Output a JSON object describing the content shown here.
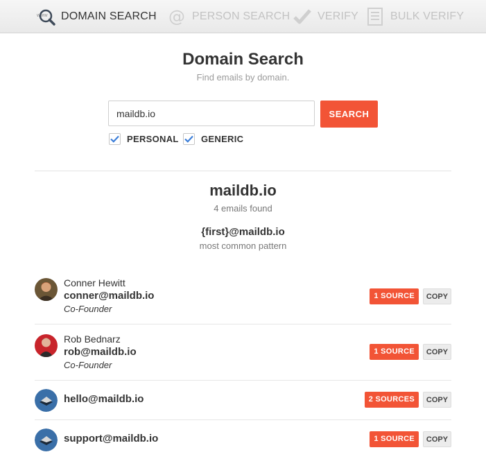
{
  "nav": {
    "domain_search": "DOMAIN SEARCH",
    "person_search": "PERSON SEARCH",
    "verify": "VERIFY",
    "bulk_verify": "BULK VERIFY",
    "icons": [
      "www-magnifier-icon",
      "at-sign-icon",
      "checkmark-icon",
      "document-list-icon"
    ],
    "active": "domain_search"
  },
  "header": {
    "title": "Domain Search",
    "subtitle": "Find emails by domain."
  },
  "search": {
    "value": "maildb.io",
    "placeholder": "",
    "button": "SEARCH",
    "filters": [
      {
        "label": "PERSONAL",
        "checked": true
      },
      {
        "label": "GENERIC",
        "checked": true
      }
    ]
  },
  "results": {
    "domain": "maildb.io",
    "count_text": "4 emails found",
    "pattern": "{first}@maildb.io",
    "pattern_caption": "most common pattern",
    "copy_label": "COPY",
    "items": [
      {
        "name": "Conner Hewitt",
        "email": "conner@maildb.io",
        "role": "Co-Founder",
        "sources": "1 SOURCE"
      },
      {
        "name": "Rob Bednarz",
        "email": "rob@maildb.io",
        "role": "Co-Founder",
        "sources": "1 SOURCE"
      },
      {
        "name": "",
        "email": "hello@maildb.io",
        "role": "",
        "sources": "2 SOURCES"
      },
      {
        "name": "",
        "email": "support@maildb.io",
        "role": "",
        "sources": "1 SOURCE"
      }
    ]
  },
  "colors": {
    "accent": "#f25436",
    "check": "#3b7dd8",
    "generic_avatar": "#3a6fa8"
  }
}
